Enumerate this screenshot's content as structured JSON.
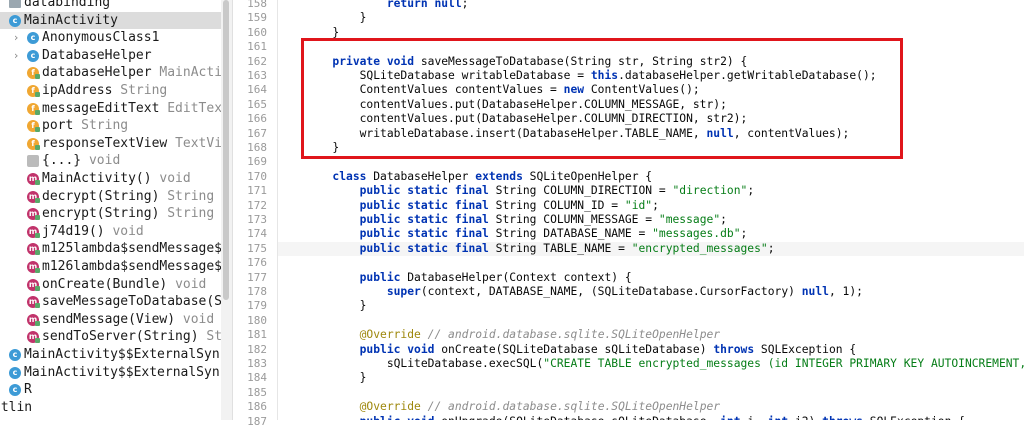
{
  "structure_tree": {
    "items": [
      {
        "name": "databinding",
        "type": "",
        "icon": "folder-icon",
        "indent": 0,
        "selected": false
      },
      {
        "name": "MainActivity",
        "type": "",
        "icon": "class-icon",
        "indent": 0,
        "selected": true
      },
      {
        "name": "AnonymousClass1",
        "type": "",
        "icon": "class-icon",
        "indent": 1,
        "selected": false,
        "chevron": true
      },
      {
        "name": "DatabaseHelper",
        "type": "",
        "icon": "class-icon",
        "indent": 1,
        "selected": false,
        "chevron": true
      },
      {
        "name": "databaseHelper",
        "type": "MainActivi",
        "icon": "field-icon",
        "indent": 1,
        "selected": false
      },
      {
        "name": "ipAddress",
        "type": "String",
        "icon": "field-icon",
        "indent": 1,
        "selected": false
      },
      {
        "name": "messageEditText",
        "type": "EditTex",
        "icon": "field-icon",
        "indent": 1,
        "selected": false
      },
      {
        "name": "port",
        "type": "String",
        "icon": "field-icon",
        "indent": 1,
        "selected": false
      },
      {
        "name": "responseTextView",
        "type": "TextVi",
        "icon": "field-icon",
        "indent": 1,
        "selected": false
      },
      {
        "name": "{...}",
        "type": "void",
        "icon": "initializer-icon",
        "indent": 1,
        "selected": false
      },
      {
        "name": "MainActivity()",
        "type": "void",
        "icon": "method-icon",
        "indent": 1,
        "selected": false
      },
      {
        "name": "decrypt(String)",
        "type": "String",
        "icon": "method-icon",
        "indent": 1,
        "selected": false
      },
      {
        "name": "encrypt(String)",
        "type": "String",
        "icon": "method-icon",
        "indent": 1,
        "selected": false
      },
      {
        "name": "j74d19()",
        "type": "void",
        "icon": "method-icon",
        "indent": 1,
        "selected": false
      },
      {
        "name": "m125lambda$sendMessage$",
        "type": "",
        "icon": "method-icon",
        "indent": 1,
        "selected": false
      },
      {
        "name": "m126lambda$sendMessage$",
        "type": "",
        "icon": "method-icon",
        "indent": 1,
        "selected": false
      },
      {
        "name": "onCreate(Bundle)",
        "type": "void",
        "icon": "method-icon",
        "indent": 1,
        "selected": false
      },
      {
        "name": "saveMessageToDatabase(S",
        "type": "",
        "icon": "method-icon",
        "indent": 1,
        "selected": false
      },
      {
        "name": "sendMessage(View)",
        "type": "void",
        "icon": "method-icon",
        "indent": 1,
        "selected": false
      },
      {
        "name": "sendToServer(String)",
        "type": "St",
        "icon": "method-icon",
        "indent": 1,
        "selected": false
      },
      {
        "name": "MainActivity$$ExternalSyn",
        "type": "",
        "icon": "class-icon",
        "indent": 0,
        "selected": false
      },
      {
        "name": "MainActivity$$ExternalSyn",
        "type": "",
        "icon": "class-icon",
        "indent": 0,
        "selected": false
      },
      {
        "name": "R",
        "type": "",
        "icon": "class-icon",
        "indent": 0,
        "selected": false
      },
      {
        "name": "otlin",
        "type": "",
        "icon": "",
        "indent": -1,
        "selected": false
      }
    ]
  },
  "editor": {
    "lines": [
      {
        "n": "158",
        "t": [
          [
            "",
            "                "
          ],
          [
            "kw",
            "return"
          ],
          [
            "",
            " "
          ],
          [
            "kw",
            "null"
          ],
          [
            "",
            ";"
          ]
        ]
      },
      {
        "n": "159",
        "t": [
          [
            "",
            "            }"
          ]
        ]
      },
      {
        "n": "160",
        "t": [
          [
            "",
            "        }"
          ]
        ]
      },
      {
        "n": "161",
        "t": [
          [
            "",
            ""
          ]
        ]
      },
      {
        "n": "162",
        "t": [
          [
            "",
            "        "
          ],
          [
            "kw",
            "private void"
          ],
          [
            "",
            " saveMessageToDatabase(String str, String str2) {"
          ]
        ]
      },
      {
        "n": "163",
        "t": [
          [
            "",
            "            SQLiteDatabase writableDatabase = "
          ],
          [
            "kw",
            "this"
          ],
          [
            "",
            ".databaseHelper.getWritableDatabase();"
          ]
        ]
      },
      {
        "n": "164",
        "t": [
          [
            "",
            "            ContentValues contentValues = "
          ],
          [
            "kw",
            "new"
          ],
          [
            "",
            " ContentValues();"
          ]
        ]
      },
      {
        "n": "165",
        "t": [
          [
            "",
            "            contentValues.put(DatabaseHelper.COLUMN_MESSAGE, str);"
          ]
        ]
      },
      {
        "n": "166",
        "t": [
          [
            "",
            "            contentValues.put(DatabaseHelper.COLUMN_DIRECTION, str2);"
          ]
        ]
      },
      {
        "n": "167",
        "t": [
          [
            "",
            "            writableDatabase.insert(DatabaseHelper.TABLE_NAME, "
          ],
          [
            "kw",
            "null"
          ],
          [
            "",
            ", contentValues);"
          ]
        ]
      },
      {
        "n": "168",
        "t": [
          [
            "",
            "        }"
          ]
        ]
      },
      {
        "n": "169",
        "t": [
          [
            "",
            ""
          ]
        ]
      },
      {
        "n": "170",
        "t": [
          [
            "",
            "        "
          ],
          [
            "kw",
            "class"
          ],
          [
            "",
            " DatabaseHelper "
          ],
          [
            "kw",
            "extends"
          ],
          [
            "",
            " SQLiteOpenHelper {"
          ]
        ]
      },
      {
        "n": "171",
        "t": [
          [
            "",
            "            "
          ],
          [
            "kw",
            "public static final"
          ],
          [
            "",
            " String COLUMN_DIRECTION = "
          ],
          [
            "str",
            "\"direction\""
          ],
          [
            "",
            ";"
          ]
        ]
      },
      {
        "n": "172",
        "t": [
          [
            "",
            "            "
          ],
          [
            "kw",
            "public static final"
          ],
          [
            "",
            " String COLUMN_ID = "
          ],
          [
            "str",
            "\"id\""
          ],
          [
            "",
            ";"
          ]
        ]
      },
      {
        "n": "173",
        "t": [
          [
            "",
            "            "
          ],
          [
            "kw",
            "public static final"
          ],
          [
            "",
            " String COLUMN_MESSAGE = "
          ],
          [
            "str",
            "\"message\""
          ],
          [
            "",
            ";"
          ]
        ]
      },
      {
        "n": "174",
        "t": [
          [
            "",
            "            "
          ],
          [
            "kw",
            "public static final"
          ],
          [
            "",
            " String DATABASE_NAME = "
          ],
          [
            "str",
            "\"messages.db\""
          ],
          [
            "",
            ";"
          ]
        ]
      },
      {
        "n": "175",
        "hl": true,
        "t": [
          [
            "",
            "            "
          ],
          [
            "kw",
            "public static final"
          ],
          [
            "",
            " String TABLE_NAME = "
          ],
          [
            "str",
            "\"encrypted_messages\""
          ],
          [
            "",
            ";"
          ]
        ]
      },
      {
        "n": "176",
        "t": [
          [
            "",
            ""
          ]
        ]
      },
      {
        "n": "177",
        "t": [
          [
            "",
            "            "
          ],
          [
            "kw",
            "public"
          ],
          [
            "",
            " DatabaseHelper(Context context) {"
          ]
        ]
      },
      {
        "n": "178",
        "t": [
          [
            "",
            "                "
          ],
          [
            "kw",
            "super"
          ],
          [
            "",
            "(context, DATABASE_NAME, (SQLiteDatabase.CursorFactory) "
          ],
          [
            "kw",
            "null"
          ],
          [
            "",
            ", 1);"
          ]
        ]
      },
      {
        "n": "179",
        "t": [
          [
            "",
            "            }"
          ]
        ]
      },
      {
        "n": "180",
        "t": [
          [
            "",
            ""
          ]
        ]
      },
      {
        "n": "181",
        "t": [
          [
            "",
            "            "
          ],
          [
            "ann",
            "@Override"
          ],
          [
            "",
            " "
          ],
          [
            "cmt",
            "// android.database.sqlite.SQLiteOpenHelper"
          ]
        ]
      },
      {
        "n": "182",
        "t": [
          [
            "",
            "            "
          ],
          [
            "kw",
            "public void"
          ],
          [
            "",
            " onCreate(SQLiteDatabase sQLiteDatabase) "
          ],
          [
            "kw",
            "throws"
          ],
          [
            "",
            " SQLException {"
          ]
        ]
      },
      {
        "n": "183",
        "t": [
          [
            "",
            "                sQLiteDatabase.execSQL("
          ],
          [
            "str",
            "\"CREATE TABLE encrypted_messages (id INTEGER PRIMARY KEY AUTOINCREMENT,"
          ]
        ]
      },
      {
        "n": "184",
        "t": [
          [
            "",
            "            }"
          ]
        ]
      },
      {
        "n": "185",
        "t": [
          [
            "",
            ""
          ]
        ]
      },
      {
        "n": "186",
        "t": [
          [
            "",
            "            "
          ],
          [
            "ann",
            "@Override"
          ],
          [
            "",
            " "
          ],
          [
            "cmt",
            "// android.database.sqlite.SQLiteOpenHelper"
          ]
        ]
      },
      {
        "n": "187",
        "t": [
          [
            "",
            "            "
          ],
          [
            "kw",
            "public void"
          ],
          [
            "",
            " onUpgrade(SQLiteDatabase sQLiteDatabase, "
          ],
          [
            "kw",
            "int"
          ],
          [
            "",
            " i, "
          ],
          [
            "kw",
            "int"
          ],
          [
            "",
            " i2) "
          ],
          [
            "kw",
            "throws"
          ],
          [
            "",
            " SQLException {"
          ]
        ]
      }
    ]
  },
  "colors": {
    "highlight_box": "#e0151b",
    "keyword": "#0033b3",
    "string": "#067d17",
    "comment": "#8c8c8c",
    "annotation": "#9e880d"
  }
}
